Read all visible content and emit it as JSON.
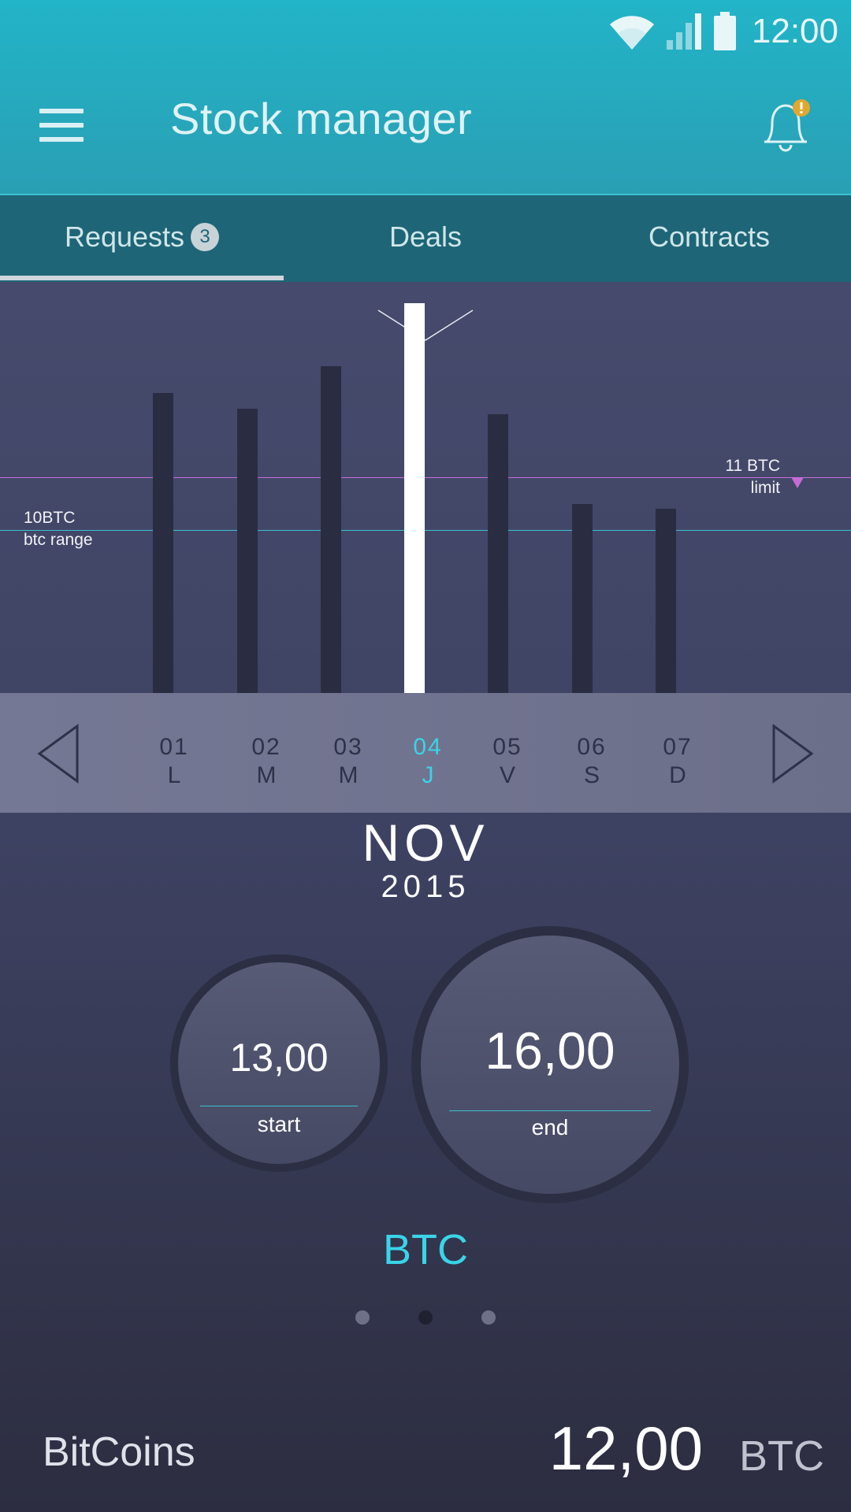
{
  "status_bar": {
    "time": "12:00"
  },
  "header": {
    "title": "Stock manager"
  },
  "tabs": [
    {
      "label": "Requests",
      "badge": "3"
    },
    {
      "label": "Deals"
    },
    {
      "label": "Contracts"
    }
  ],
  "chart_data": {
    "type": "bar",
    "categories": [
      "01",
      "02",
      "03",
      "04",
      "05",
      "06",
      "07"
    ],
    "values": [
      12.6,
      12.3,
      13.1,
      14.3,
      12.2,
      10.5,
      10.4
    ],
    "highlighted_index": 3,
    "reference_lines": [
      {
        "value": "11 BTC",
        "label": "limit",
        "color": "#c66bd6"
      },
      {
        "value": "10BTC",
        "label": "btc range",
        "color": "#3bbfd0"
      }
    ]
  },
  "date_picker": {
    "days": [
      {
        "num": "01",
        "letter": "L"
      },
      {
        "num": "02",
        "letter": "M"
      },
      {
        "num": "03",
        "letter": "M"
      },
      {
        "num": "04",
        "letter": "J"
      },
      {
        "num": "05",
        "letter": "V"
      },
      {
        "num": "06",
        "letter": "S"
      },
      {
        "num": "07",
        "letter": "D"
      }
    ],
    "selected_index": 3,
    "month": "NOV",
    "year": "2015"
  },
  "range": {
    "start_value": "13,00",
    "start_label": "start",
    "end_value": "16,00",
    "end_label": "end",
    "currency": "BTC"
  },
  "pager": {
    "count": 3,
    "active_index": 1
  },
  "footer": {
    "label": "BitCoins",
    "value": "12,00",
    "unit": "BTC"
  },
  "colors": {
    "accent": "#3ad4e8",
    "limit_line": "#c66bd6",
    "range_line": "#3bbfd0",
    "notification": "#e0a82e"
  }
}
